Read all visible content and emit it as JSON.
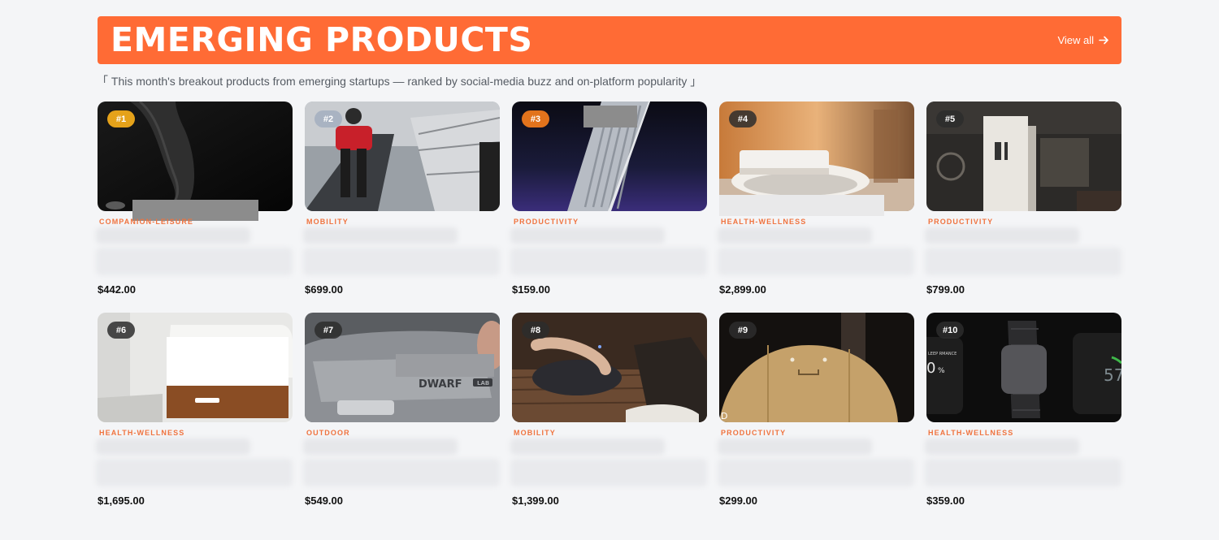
{
  "header": {
    "title": "EMERGING PRODUCTS",
    "view_all": "View all",
    "subtitle": "「 This month's breakout products from emerging startups — ranked by social-media buzz and on-platform popularity 」"
  },
  "products": [
    {
      "rank": "#1",
      "category": "COMPANION-LEISURE",
      "price": "$442.00"
    },
    {
      "rank": "#2",
      "category": "MOBILITY",
      "price": "$699.00"
    },
    {
      "rank": "#3",
      "category": "PRODUCTIVITY",
      "price": "$159.00"
    },
    {
      "rank": "#4",
      "category": "HEALTH-WELLNESS",
      "price": "$2,899.00"
    },
    {
      "rank": "#5",
      "category": "PRODUCTIVITY",
      "price": "$799.00"
    },
    {
      "rank": "#6",
      "category": "HEALTH-WELLNESS",
      "price": "$1,695.00"
    },
    {
      "rank": "#7",
      "category": "OUTDOOR",
      "price": "$549.00"
    },
    {
      "rank": "#8",
      "category": "MOBILITY",
      "price": "$1,399.00"
    },
    {
      "rank": "#9",
      "category": "PRODUCTIVITY",
      "price": "$299.00"
    },
    {
      "rank": "#10",
      "category": "HEALTH-WELLNESS",
      "price": "$359.00"
    }
  ],
  "image_text": {
    "dwarf_logo": "DWARF",
    "dwarf_lab": "LAB",
    "watch_screen_left": "0",
    "watch_screen_pct": "%",
    "watch_screen_right": "57",
    "watch_screen_label": "LEEP\nRMANCE",
    "robot_letter": "D"
  },
  "colors": {
    "accent": "#ff6b35",
    "category": "#f0723d",
    "rank_gold": "#e5a21a",
    "rank_silver": "#a9b3c2",
    "rank_bronze": "#e2731c",
    "rank_default": "#2d2d2d"
  },
  "icons": {
    "view_all": "arrow-right-icon"
  }
}
